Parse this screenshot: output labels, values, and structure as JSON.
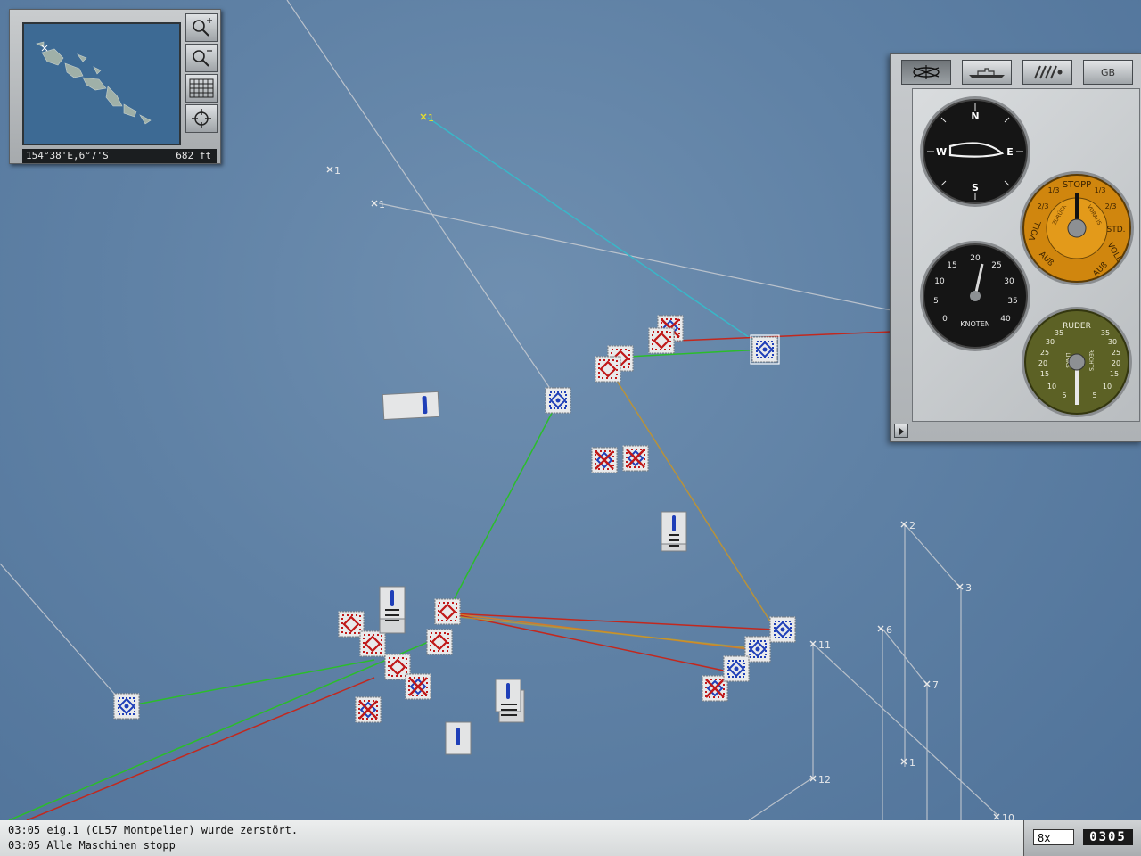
{
  "minimap": {
    "coords": "154°38'E,6°7'S",
    "altitude": "682 ft",
    "zoom_in_icon": "magnifier-plus-icon",
    "zoom_out_icon": "magnifier-minus-icon",
    "grid_icon": "grid-icon",
    "center_icon": "crosshair-icon"
  },
  "panel": {
    "tabs": [
      "ship-helm-icon",
      "ship-silhouette-icon",
      "weapons-icon",
      "GB"
    ],
    "compass": {
      "n": "N",
      "e": "E",
      "s": "S",
      "w": "W"
    },
    "telegraph": {
      "stop": "STOPP",
      "fractions": [
        "1/3",
        "2/3",
        "1/3",
        "2/3"
      ],
      "left_full": "VOLL",
      "right_full": "VOLL",
      "std": "STD.",
      "ao_left": "AUß",
      "ao_right": "AUß",
      "back_word": "ZURÜCK",
      "fwd_word": "VORAUS"
    },
    "speedometer": {
      "label": "KNOTEN",
      "ticks": [
        "0",
        "5",
        "10",
        "15",
        "20",
        "25",
        "30",
        "35",
        "40"
      ]
    },
    "rudder": {
      "label": "RUDER",
      "left": "LINKS",
      "right": "RECHTS",
      "ticks": [
        "35",
        "30",
        "25",
        "20",
        "15",
        "10",
        "5"
      ]
    }
  },
  "waypoints": [
    "1",
    "1",
    "1",
    "2",
    "3",
    "6",
    "7",
    "11",
    "1",
    "12",
    "10"
  ],
  "log": {
    "line1": "03:05 eig.1 (CL57 Montpelier) wurde zerstört.",
    "line2": "03:05 Alle Maschinen stopp"
  },
  "time": {
    "speed": "8x",
    "clock": "0305"
  },
  "colors": {
    "water": "#5f81a5",
    "friendly": "#1f3fb8",
    "enemy": "#c01818",
    "course_green": "#2bbd2b",
    "course_red": "#c2281e",
    "course_cyan": "#39b7c8"
  }
}
